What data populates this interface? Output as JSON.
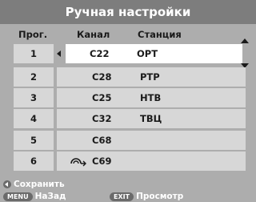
{
  "title": "Ручная настройки",
  "header": {
    "prog": "Прог.",
    "channel": "Канал",
    "station": "Станция"
  },
  "rows": [
    {
      "num": "1",
      "channel": "C22",
      "station": "ОРТ"
    },
    {
      "num": "2",
      "channel": "C28",
      "station": "РТР"
    },
    {
      "num": "3",
      "channel": "C25",
      "station": "НТВ"
    },
    {
      "num": "4",
      "channel": "C32",
      "station": "ТВЦ"
    },
    {
      "num": "5",
      "channel": "C68",
      "station": ""
    },
    {
      "num": "6",
      "channel": "C69",
      "station": ""
    }
  ],
  "footer": {
    "save": "Сохранить",
    "menu_key": "MENU",
    "back": "НаЗад",
    "exit_key": "EXIT",
    "view": "Просмотр"
  },
  "colors": {
    "background": "#adadad",
    "title_bar": "#7d7d7d",
    "row": "#d7d7d7",
    "selected": "#ffffff"
  },
  "icons": {
    "selected_marker": "left-arrow-icon",
    "skip": "skip-signal-icon"
  }
}
